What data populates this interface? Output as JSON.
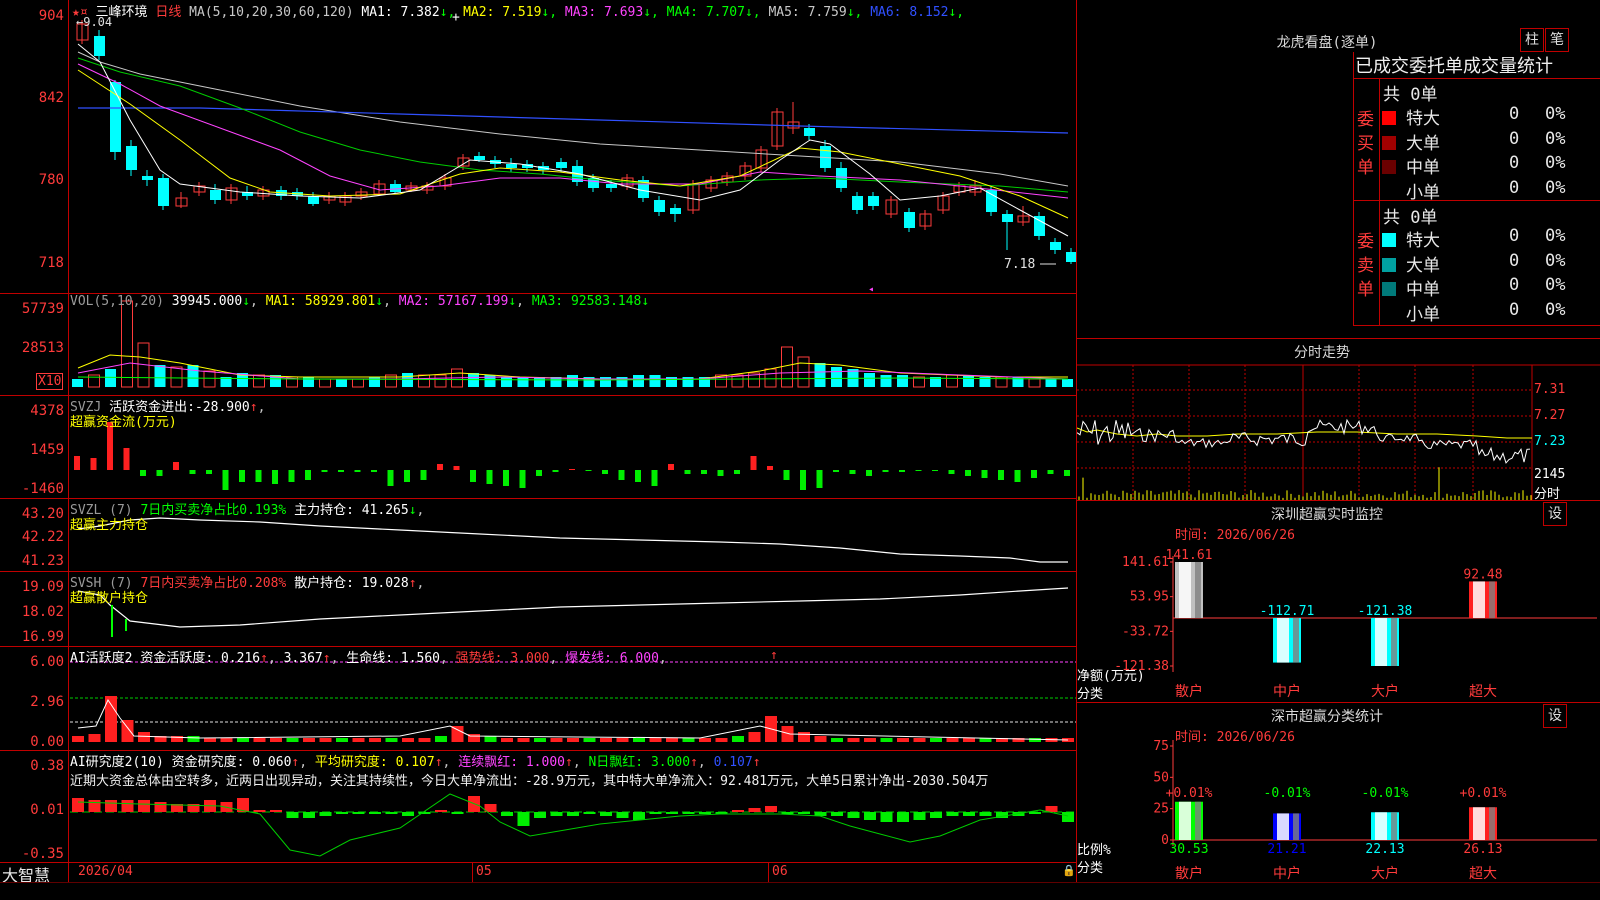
{
  "stock": {
    "name": "三峰环境",
    "period": "日线"
  },
  "main_chart": {
    "ma_label": "MA(5,10,20,30,60,120)",
    "ma": [
      {
        "name": "MA1:",
        "value": "7.382",
        "color": "#ffffff"
      },
      {
        "name": "MA2:",
        "value": "7.519",
        "color": "#ffff00"
      },
      {
        "name": "MA3:",
        "value": "7.693",
        "color": "#ff44ff"
      },
      {
        "name": "MA4:",
        "value": "7.707",
        "color": "#00ff00"
      },
      {
        "name": "MA5:",
        "value": "7.759",
        "color": "#c8c8c8"
      },
      {
        "name": "MA6:",
        "value": "8.152",
        "color": "#3050ff"
      }
    ],
    "y_ticks": [
      "904",
      "842",
      "780",
      "718"
    ],
    "high_label": "9.04",
    "low_label": "7.18"
  },
  "vol": {
    "label": "VOL(5,10,20)",
    "value": "39945.000",
    "ma1": "MA1: 58929.801",
    "ma2": "MA2: 57167.199",
    "ma3": "MA3: 92583.148",
    "y_ticks": [
      "57739",
      "28513"
    ],
    "unit": "X10"
  },
  "svzj": {
    "label": "SVZJ",
    "title": "活跃资金进出:",
    "value": "-28.900",
    "subtitle": "超赢资金流(万元)",
    "y_ticks": [
      "4378",
      "1459",
      "-1460"
    ]
  },
  "svzl": {
    "label": "SVZL (7)",
    "text1": "7日内买卖净占比0.193%",
    "text2": "主力持仓:",
    "value": "41.265",
    "subtitle": "超赢主力持仓",
    "y_ticks": [
      "43.20",
      "42.22",
      "41.23"
    ]
  },
  "svsh": {
    "label": "SVSH (7)",
    "text1": "7日内买卖净占比0.208%",
    "text2": "散户持仓:",
    "value": "19.028",
    "subtitle": "超赢散户持仓",
    "y_ticks": [
      "19.09",
      "18.02",
      "16.99"
    ]
  },
  "ai_active": {
    "label": "AI活跃度2",
    "t1": "资金活跃度:",
    "v1": "0.216",
    "v2": "3.367",
    "t3": "生命线:",
    "v3": "1.560",
    "t4": "强势线:",
    "v4": "3.000",
    "t5": "爆发线:",
    "v5": "6.000",
    "y_ticks": [
      "6.00",
      "2.96",
      "0.00"
    ]
  },
  "ai_research": {
    "label": "AI研究度2(10)",
    "t1": "资金研究度:",
    "v1": "0.060",
    "t2": "平均研究度:",
    "v2": "0.107",
    "t3": "连续飘红:",
    "v3": "1.000",
    "t4": "N日飘红:",
    "v4": "3.000",
    "v5": "0.107",
    "comment": "近期大资金总体由空转多，近两日出现异动，关注其持续性，今日大单净流出：-28.9万元，其中特大单净流入：92.481万元，大单5日累计净出-2030.504万",
    "y_ticks": [
      "0.38",
      "0.01",
      "-0.35"
    ]
  },
  "x_axis": {
    "labels": [
      "2026/04",
      "05",
      "06"
    ]
  },
  "app_name": "大智慧",
  "right": {
    "lhb": {
      "title": "龙虎看盘(逐单)",
      "btn1": "柱",
      "btn2": "笔",
      "header": "已成交委托单成交量统计",
      "buy": {
        "label": "委买单",
        "total": "共 0单",
        "rows": [
          {
            "name": "特大",
            "count": "0",
            "pct": "0%",
            "color": "#ff0000"
          },
          {
            "name": "大单",
            "count": "0",
            "pct": "0%",
            "color": "#a00000"
          },
          {
            "name": "中单",
            "count": "0",
            "pct": "0%",
            "color": "#6a0000"
          },
          {
            "name": "小单",
            "count": "0",
            "pct": "0%",
            "color": "#000000"
          }
        ]
      },
      "sell": {
        "label": "委卖单",
        "total": "共 0单",
        "rows": [
          {
            "name": "特大",
            "count": "0",
            "pct": "0%",
            "color": "#00ffff"
          },
          {
            "name": "大单",
            "count": "0",
            "pct": "0%",
            "color": "#00a0a0"
          },
          {
            "name": "中单",
            "count": "0",
            "pct": "0%",
            "color": "#007a7a"
          },
          {
            "name": "小单",
            "count": "0",
            "pct": "0%",
            "color": "#000000"
          }
        ]
      }
    },
    "intraday": {
      "title": "分时走势",
      "prices": [
        "7.31",
        "7.27",
        "7.23"
      ],
      "vol_max": "2145",
      "unit": "分时"
    },
    "sz_monitor": {
      "title": "深圳超赢实时监控",
      "set": "设",
      "time": "时间: 2026/06/26",
      "y_ticks": [
        "141.61",
        "53.95",
        "-33.72",
        "-121.38"
      ],
      "ylabel": "净额(万元)",
      "xlabel": "分类"
    },
    "sz_class": {
      "title": "深市超赢分类统计",
      "set": "设",
      "time": "时间: 2026/06/26",
      "y_ticks": [
        "75",
        "50",
        "25",
        "0"
      ],
      "ylabel": "比例%",
      "xlabel": "分类"
    }
  },
  "chart_data": [
    {
      "type": "bar",
      "title": "深圳超赢实时监控",
      "categories": [
        "散户",
        "中户",
        "大户",
        "超大"
      ],
      "values": [
        141.61,
        -112.71,
        -121.38,
        92.48
      ],
      "labels": [
        "141.61",
        "-112.71",
        "-121.38",
        "92.48"
      ],
      "ylabel": "净额(万元)",
      "xlabel": "分类",
      "ylim": [
        -121.38,
        141.61
      ]
    },
    {
      "type": "bar",
      "title": "深市超赢分类统计",
      "categories": [
        "散户",
        "中户",
        "大户",
        "超大"
      ],
      "values": [
        30.53,
        21.21,
        22.13,
        26.13
      ],
      "labels": [
        "30.53",
        "21.21",
        "22.13",
        "26.13"
      ],
      "changes": [
        "+0.01%",
        "-0.01%",
        "-0.01%",
        "+0.01%"
      ],
      "ylabel": "比例%",
      "xlabel": "分类",
      "ylim": [
        0,
        75
      ]
    }
  ]
}
